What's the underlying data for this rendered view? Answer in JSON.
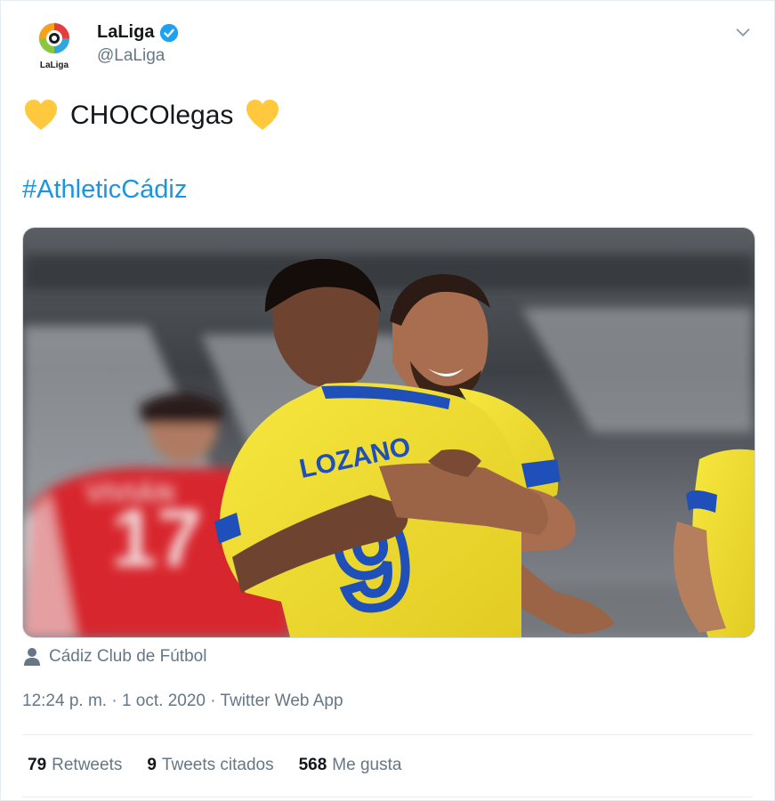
{
  "account": {
    "name": "LaLiga",
    "handle": "@LaLiga",
    "logo_text": "LaLiga",
    "verified_icon": "verified-badge-icon"
  },
  "tweet": {
    "emoji": "yellow-heart",
    "text": "CHOCOlegas",
    "hashtag": "#AthleticCádiz"
  },
  "media": {
    "jersey_name": "LOZANO",
    "jersey_number": "9",
    "opponent_number": "17",
    "opponent_name": "VIVIÁN"
  },
  "tagged": {
    "icon": "person-icon",
    "name": "Cádiz Club de Fútbol"
  },
  "meta": {
    "time": "12:24 p. m.",
    "sep1": " · ",
    "date": "1 oct. 2020",
    "sep2": " · ",
    "source": "Twitter Web App"
  },
  "stats": {
    "retweets_count": "79",
    "retweets_label": "Retweets",
    "quotes_count": "9",
    "quotes_label": "Tweets citados",
    "likes_count": "568",
    "likes_label": "Me gusta"
  },
  "colors": {
    "link": "#1b95e0",
    "secondary_text": "#657786",
    "heart": "#ffc83d",
    "cadiz_yellow": "#f5e03a",
    "cadiz_blue": "#1f4fb8",
    "opponent_red": "#d8282f"
  }
}
